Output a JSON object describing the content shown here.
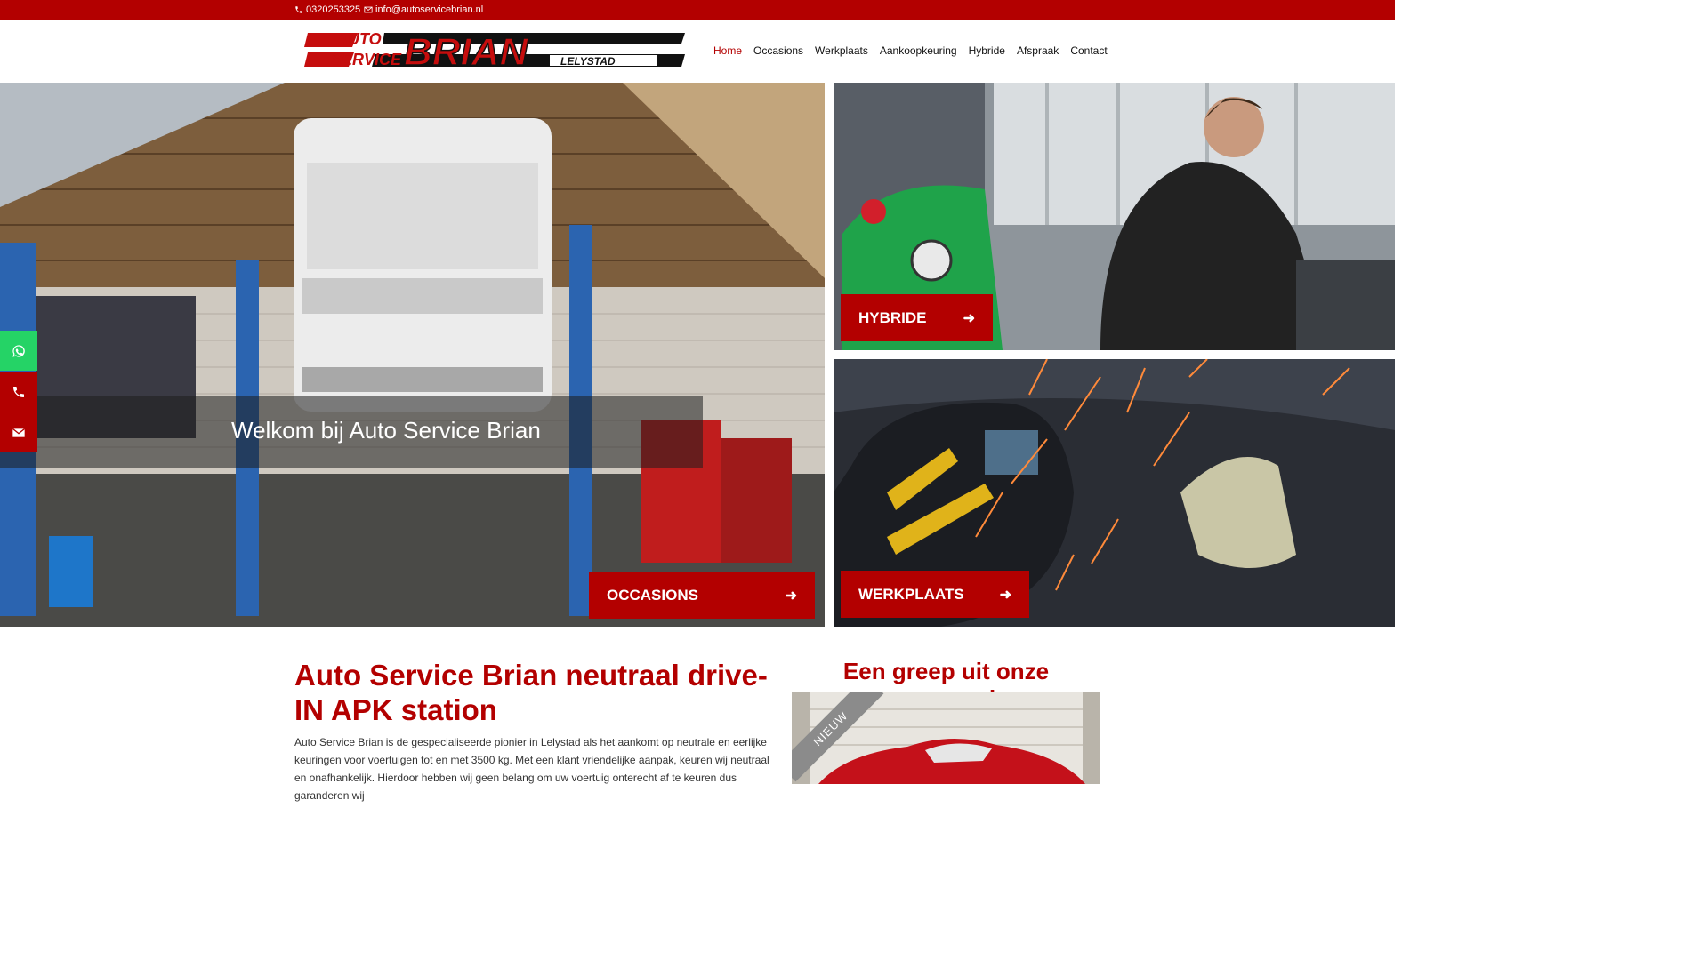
{
  "topbar": {
    "phone": "0320253325",
    "email": "info@autoservicebrian.nl"
  },
  "logo": {
    "line1": "AUTO",
    "line2": "SERVICE",
    "name": "BRIAN",
    "city": "LELYSTAD"
  },
  "nav": {
    "items": [
      {
        "label": "Home",
        "active": true
      },
      {
        "label": "Occasions"
      },
      {
        "label": "Werkplaats"
      },
      {
        "label": "Aankoopkeuring"
      },
      {
        "label": "Hybride"
      },
      {
        "label": "Afspraak"
      },
      {
        "label": "Contact"
      }
    ]
  },
  "hero": {
    "welcome": "Welkom bij Auto Service Brian",
    "occasions_label": "OCCASIONS",
    "hybride_label": "HYBRIDE",
    "werkplaats_label": "WERKPLAATS",
    "arrow": "➜"
  },
  "side": {
    "icons": [
      "whatsapp-icon",
      "phone-icon",
      "envelope-icon"
    ]
  },
  "content": {
    "title": "Auto Service Brian neutraal drive-IN APK station",
    "body": "Auto Service Brian is de gespecialiseerde pionier in Lelystad als het aankomt op neutrale en eerlijke keuringen voor voertuigen tot en met 3500 kg. Met een klant vriendelijke aanpak, keuren wij neutraal en onafhankelijk. Hierdoor hebben wij geen belang om uw voertuig onterecht af te keuren dus garanderen wij"
  },
  "stock": {
    "title": "Een greep uit onze voorraad",
    "ribbon": "NIEUW"
  },
  "colors": {
    "accent": "#b30000",
    "ribbon": "#8b8b8b",
    "whatsapp": "#25d366"
  }
}
